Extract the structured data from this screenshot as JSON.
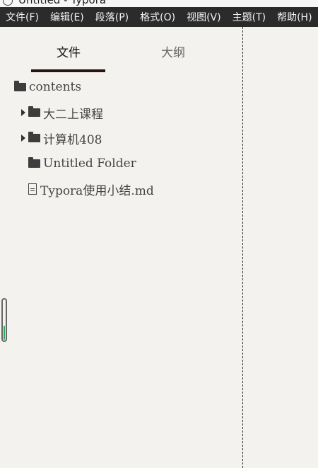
{
  "window": {
    "title": "Untitled - Typora"
  },
  "menubar": {
    "items": [
      {
        "label": "文件(F)"
      },
      {
        "label": "编辑(E)"
      },
      {
        "label": "段落(P)"
      },
      {
        "label": "格式(O)"
      },
      {
        "label": "视图(V)"
      },
      {
        "label": "主题(T)"
      },
      {
        "label": "帮助(H)"
      }
    ]
  },
  "sidebar": {
    "tabs": {
      "files": "文件",
      "outline": "大纲"
    },
    "root": {
      "label": "contents",
      "icon": "folder-icon"
    },
    "items": [
      {
        "label": "大二上课程",
        "icon": "folder-icon",
        "expandable": true
      },
      {
        "label": "计算机408",
        "icon": "folder-icon",
        "expandable": true
      },
      {
        "label": "Untitled Folder",
        "icon": "folder-icon",
        "expandable": false
      },
      {
        "label": "Typora使用小结.md",
        "icon": "file-icon",
        "expandable": false
      }
    ],
    "scroll_level": 0.35
  },
  "colors": {
    "menubar_bg": "#2b2b2b",
    "sidebar_bg": "#f3f2ef",
    "tab_underline": "#2a1412",
    "scroll_accent": "#2faa5a"
  }
}
